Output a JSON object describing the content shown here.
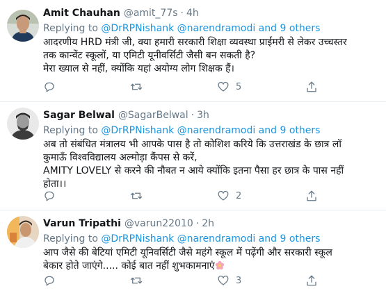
{
  "tweets": [
    {
      "name": "Amit Chauhan",
      "handle": "@amit_77s",
      "dot": "·",
      "time": "4h",
      "replying_prefix": "Replying to",
      "replying_to": "@DrRPNishank @narendramodi and 9 others",
      "lines": [
        "आदरणीय HRD मंत्री जी, क्या हमारी सरकारी शिक्षा व्यवस्था प्राईमरी से लेकर उच्चस्तर",
        "तक कान्वेंट स्कूलों, या एमिटी यूनीवर्सिटी जैसी बन सकती है?",
        "मेरा ख्याल से नहीं, क्योंकि यहां अयोग्य लोग शिक्षक हैं।"
      ],
      "likes": "5"
    },
    {
      "name": "Sagar Belwal",
      "handle": "@SagarBelwal",
      "dot": "·",
      "time": "3h",
      "replying_prefix": "Replying to",
      "replying_to": "@DrRPNishank @narendramodi and 9 others",
      "lines": [
        "अब तो संबंधित मंत्रालय भी आपके पास है तो कोशिश करिये कि उत्तराखंड के छात्र लॉ",
        "कुमाऊँ विश्वविद्यालय अल्मोड़ा कैंपस से करें,",
        "AMITY LOVELY से करने की नौबत न आये क्योंकि इतना पैसा हर छात्र के पास नहीं",
        "होता।।"
      ],
      "likes": "2"
    },
    {
      "name": "Varun Tripathi",
      "handle": "@varun22010",
      "dot": "·",
      "time": "2h",
      "replying_prefix": "Replying to",
      "replying_to": "@DrRPNishank @narendramodi and 9 others",
      "lines": [
        "आप जैसे की बेटियां एमिटी यूनिवर्सिटी जैसे महंगे स्कूल में पढ़ेंगी और सरकारी स्कूल",
        "बेकार होते जाएंगे..... कोई बात नहीं शुभकामनाएं"
      ],
      "likes": "3"
    }
  ],
  "icons": [
    "reply-icon",
    "retweet-icon",
    "like-icon",
    "share-icon",
    "flower-emoji"
  ],
  "colors": {
    "link": "#1b95e0",
    "muted": "#657786",
    "text": "#14171a",
    "divider": "#e6ecf0"
  }
}
